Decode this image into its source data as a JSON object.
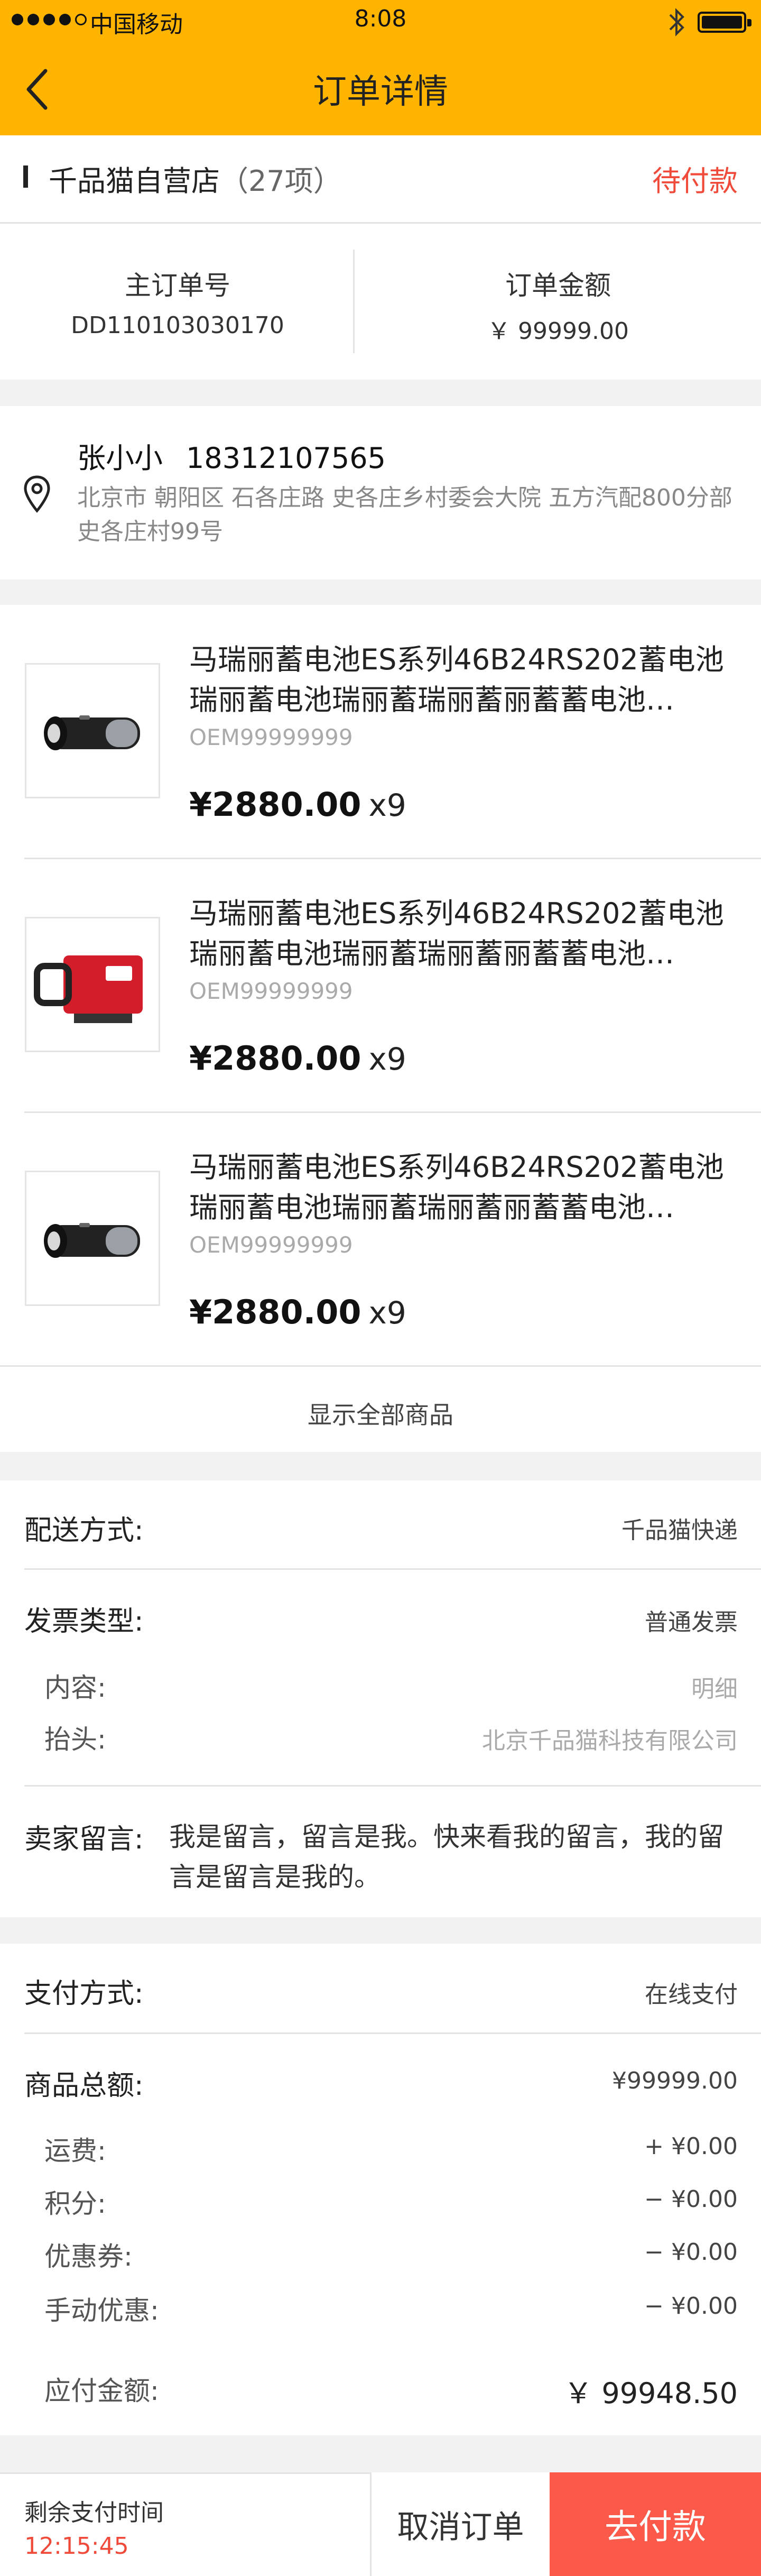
{
  "status_bar": {
    "carrier": "中国移动",
    "time": "8:08"
  },
  "nav": {
    "title": "订单详情"
  },
  "store": {
    "name": "千品猫自营店",
    "count": "（27项）",
    "status": "待付款"
  },
  "summary": {
    "order_no_label": "主订单号",
    "order_no": "DD110103030170",
    "amount_label": "订单金额",
    "amount": "￥ 99999.00"
  },
  "address": {
    "name": "张小小",
    "phone": "18312107565",
    "detail": "北京市 朝阳区 石各庄路 史各庄乡村委会大院 五方汽配800分部史各庄村99号"
  },
  "products": [
    {
      "title": "马瑞丽蓄电池ES系列46B24RS202蓄电池瑞丽蓄电池瑞丽蓄瑞丽蓄丽蓄蓄电池…",
      "oem": "OEM99999999",
      "price": "¥2880.00",
      "qty": "x9",
      "image": "black-flashlight"
    },
    {
      "title": "马瑞丽蓄电池ES系列46B24RS202蓄电池瑞丽蓄电池瑞丽蓄瑞丽蓄丽蓄蓄电池…",
      "oem": "OEM99999999",
      "price": "¥2880.00",
      "qty": "x9",
      "image": "red-tool"
    },
    {
      "title": "马瑞丽蓄电池ES系列46B24RS202蓄电池瑞丽蓄电池瑞丽蓄瑞丽蓄丽蓄蓄电池…",
      "oem": "OEM99999999",
      "price": "¥2880.00",
      "qty": "x9",
      "image": "black-flashlight"
    }
  ],
  "show_all": "显示全部商品",
  "delivery": {
    "label": "配送方式:",
    "value": "千品猫快递"
  },
  "invoice": {
    "label": "发票类型:",
    "value": "普通发票",
    "content_label": "内容:",
    "content_value": "明细",
    "header_label": "抬头:",
    "header_value": "北京千品猫科技有限公司"
  },
  "seller_msg": {
    "label": "卖家留言:",
    "text": "我是留言，留言是我。快来看我的留言，我的留言是留言是我的。"
  },
  "payment": {
    "label": "支付方式:",
    "value": "在线支付"
  },
  "totals": {
    "goods_label": "商品总额:",
    "goods_value": "¥99999.00",
    "freight_label": "运费:",
    "freight_value": "+ ¥0.00",
    "points_label": "积分:",
    "points_value": "− ¥0.00",
    "coupon_label": "优惠券:",
    "coupon_value": "− ¥0.00",
    "manual_label": "手动优惠:",
    "manual_value": "− ¥0.00",
    "payable_label": "应付金额:",
    "payable_value": "￥ 99948.50"
  },
  "bottom": {
    "remain_label": "剩余支付时间",
    "remain_time": "12:15:45",
    "cancel": "取消订单",
    "pay": "去付款"
  },
  "colors": {
    "brand": "#ffb400",
    "accent": "#f04b3a",
    "pay_button": "#fb5a4b"
  }
}
